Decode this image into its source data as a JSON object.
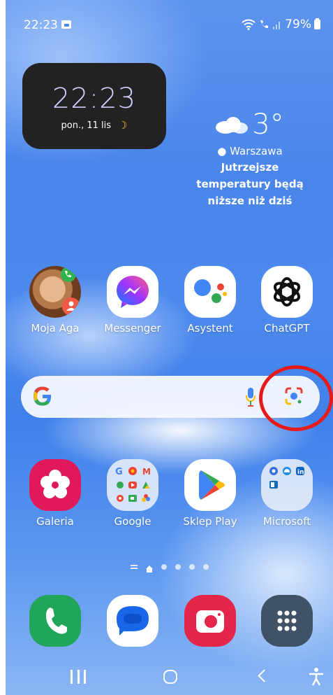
{
  "status_bar": {
    "time": "22:23",
    "battery": "79%"
  },
  "clock_widget": {
    "time": "22:23",
    "date": "pon., 11 lis"
  },
  "weather_widget": {
    "temperature": "3°",
    "location": "Warszawa",
    "message_line1": "Jutrzejsze",
    "message_line2": "temperatury będą",
    "message_line3": "niższe niż dziś"
  },
  "apps_row1": [
    {
      "label": "Moja Aga"
    },
    {
      "label": "Messenger"
    },
    {
      "label": "Asystent"
    },
    {
      "label": "ChatGPT"
    }
  ],
  "apps_row2": [
    {
      "label": "Galeria"
    },
    {
      "label": "Google"
    },
    {
      "label": "Sklep Play"
    },
    {
      "label": "Microsoft"
    }
  ],
  "colors": {
    "annotation_circle": "#e81919",
    "clock_text": "#cfd0ff",
    "wallpaper_blue": "#4a86ea"
  },
  "icons": {
    "search_bar": [
      "google-g-icon",
      "microphone-icon",
      "google-lens-icon"
    ],
    "navigation": [
      "recent-apps-icon",
      "home-icon",
      "back-icon",
      "accessibility-icon"
    ],
    "dock": [
      "phone-icon",
      "messages-icon",
      "camera-icon",
      "app-drawer-icon"
    ]
  },
  "page_indicator": {
    "pages": 5,
    "active": 0
  }
}
